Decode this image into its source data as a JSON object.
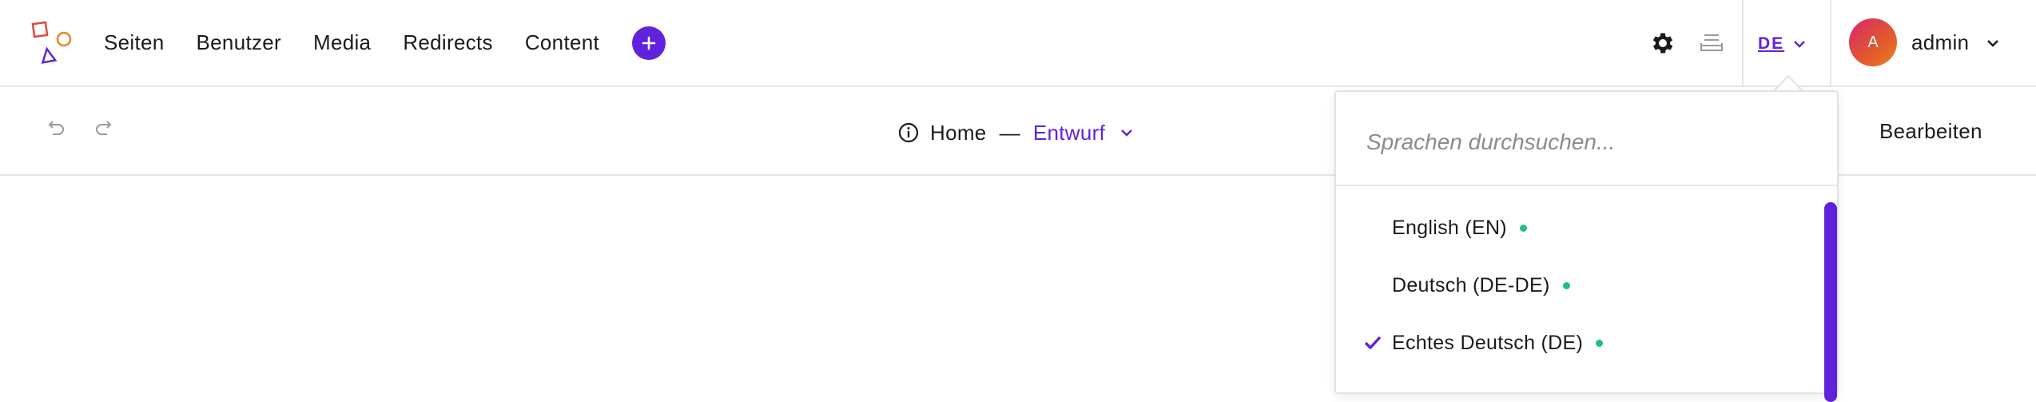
{
  "nav": {
    "items": [
      {
        "label": "Seiten"
      },
      {
        "label": "Benutzer"
      },
      {
        "label": "Media"
      },
      {
        "label": "Redirects"
      },
      {
        "label": "Content"
      }
    ]
  },
  "header": {
    "language_code": "DE",
    "avatar_initial": "A",
    "user_name": "admin"
  },
  "toolbar": {
    "page_name": "Home",
    "separator": "—",
    "status": "Entwurf",
    "edit_label": "Bearbeiten"
  },
  "language_dropdown": {
    "search_placeholder": "Sprachen durchsuchen...",
    "languages": [
      {
        "label": "English (EN)",
        "selected": false
      },
      {
        "label": "Deutsch (DE-DE)",
        "selected": false
      },
      {
        "label": "Echtes Deutsch (DE)",
        "selected": true
      }
    ]
  },
  "colors": {
    "accent": "#6122db",
    "status_dot": "#1fbf85",
    "border": "#e6e6e6"
  },
  "icons": [
    "logo-icon",
    "plus-icon",
    "gear-icon",
    "tray-icon",
    "chevron-down-icon",
    "undo-icon",
    "redo-icon",
    "info-icon",
    "check-icon"
  ]
}
